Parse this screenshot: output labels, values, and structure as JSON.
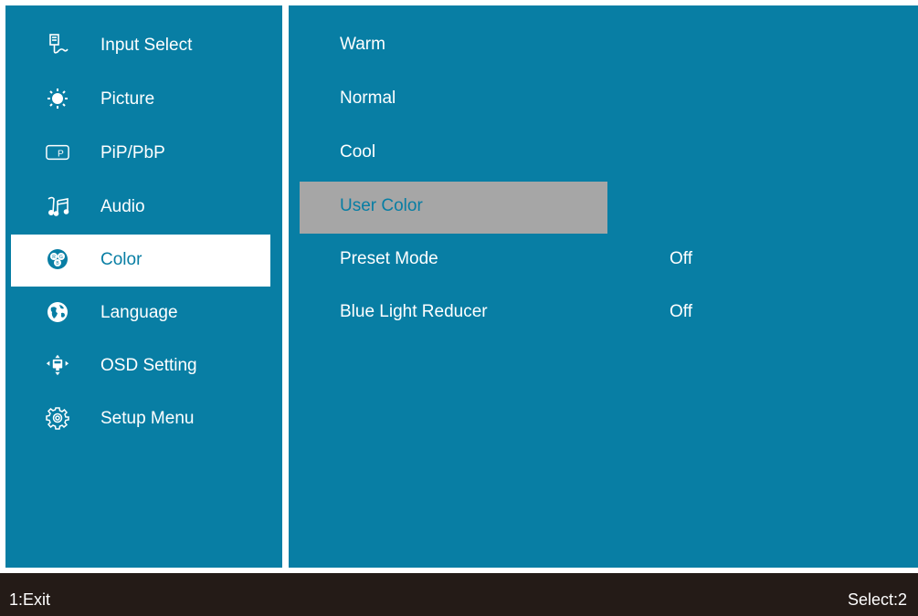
{
  "menu": {
    "items": [
      {
        "label": "Input Select",
        "icon": "input-select-icon"
      },
      {
        "label": "Picture",
        "icon": "brightness-icon"
      },
      {
        "label": "PiP/PbP",
        "icon": "pip-icon"
      },
      {
        "label": "Audio",
        "icon": "audio-icon"
      },
      {
        "label": "Color",
        "icon": "rgb-icon",
        "selected": true
      },
      {
        "label": "Language",
        "icon": "globe-icon"
      },
      {
        "label": "OSD Setting",
        "icon": "osd-setting-icon"
      },
      {
        "label": "Setup Menu",
        "icon": "gear-icon"
      }
    ]
  },
  "color_menu": {
    "items": [
      {
        "label": "Warm",
        "value": ""
      },
      {
        "label": "Normal",
        "value": ""
      },
      {
        "label": "Cool",
        "value": ""
      },
      {
        "label": "User Color",
        "value": "",
        "highlighted": true
      },
      {
        "label": "Preset Mode",
        "value": "Off"
      },
      {
        "label": "Blue Light Reducer",
        "value": "Off"
      }
    ]
  },
  "footer": {
    "exit_label": "1:Exit",
    "select_label": "Select:2"
  },
  "colors": {
    "panel": "#087ea4",
    "selected_bg": "#ffffff",
    "highlight_bg": "#a6a6a6",
    "footer_bg": "#241b17"
  }
}
